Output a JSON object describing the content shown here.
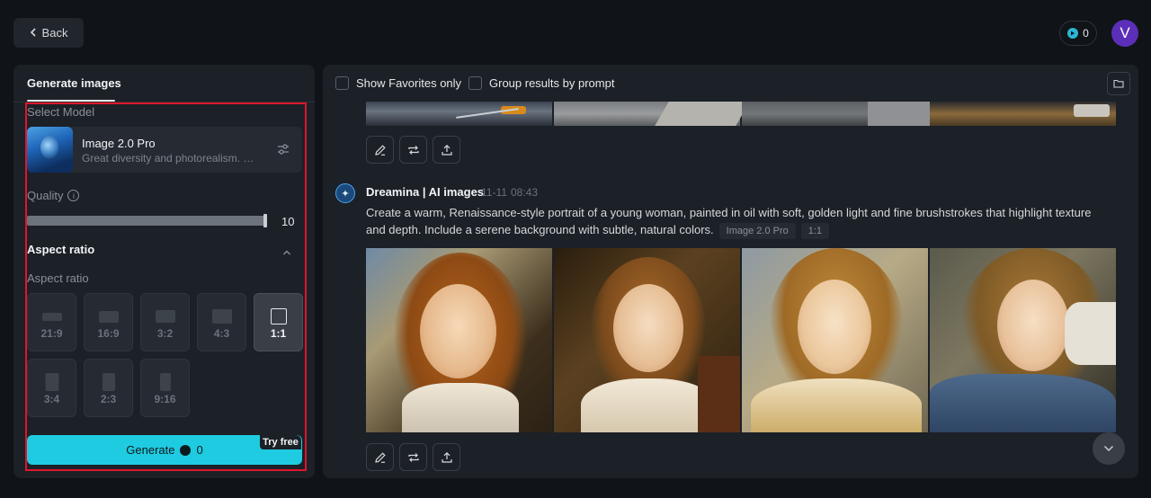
{
  "header": {
    "back_label": "Back",
    "credits": "0",
    "avatar_initial": "V"
  },
  "left_panel": {
    "tab_label": "Generate images",
    "select_model_label": "Select Model",
    "model": {
      "name": "Image 2.0 Pro",
      "description": "Great diversity and photorealism. Of..."
    },
    "quality_label": "Quality",
    "quality_value": "10",
    "quality_level": 1.0,
    "aspect_ratio_title": "Aspect ratio",
    "aspect_ratio_sub": "Aspect ratio",
    "aspect_ratios": [
      {
        "label": "21:9",
        "selected": false
      },
      {
        "label": "16:9",
        "selected": false
      },
      {
        "label": "3:2",
        "selected": false
      },
      {
        "label": "4:3",
        "selected": false
      },
      {
        "label": "1:1",
        "selected": true
      },
      {
        "label": "3:4",
        "selected": false
      },
      {
        "label": "2:3",
        "selected": false
      },
      {
        "label": "9:16",
        "selected": false
      }
    ],
    "generate_label": "Generate",
    "generate_cost": "0",
    "try_free_label": "Try free"
  },
  "right_panel": {
    "show_favorites_label": "Show Favorites only",
    "group_results_label": "Group results by prompt",
    "result": {
      "author": "Dreamina | AI images",
      "date": "11-11",
      "time": "08:43",
      "prompt": "Create a warm, Renaissance-style portrait of a young woman, painted in oil with soft, golden light and fine brushstrokes that highlight texture and depth. Include a serene background with subtle, natural colors.",
      "model_tag": "Image 2.0 Pro",
      "ratio_tag": "1:1"
    }
  },
  "colors": {
    "accent": "#1fcbe0",
    "highlight_border": "#e0162b",
    "avatar_bg": "#5b2fb8"
  }
}
